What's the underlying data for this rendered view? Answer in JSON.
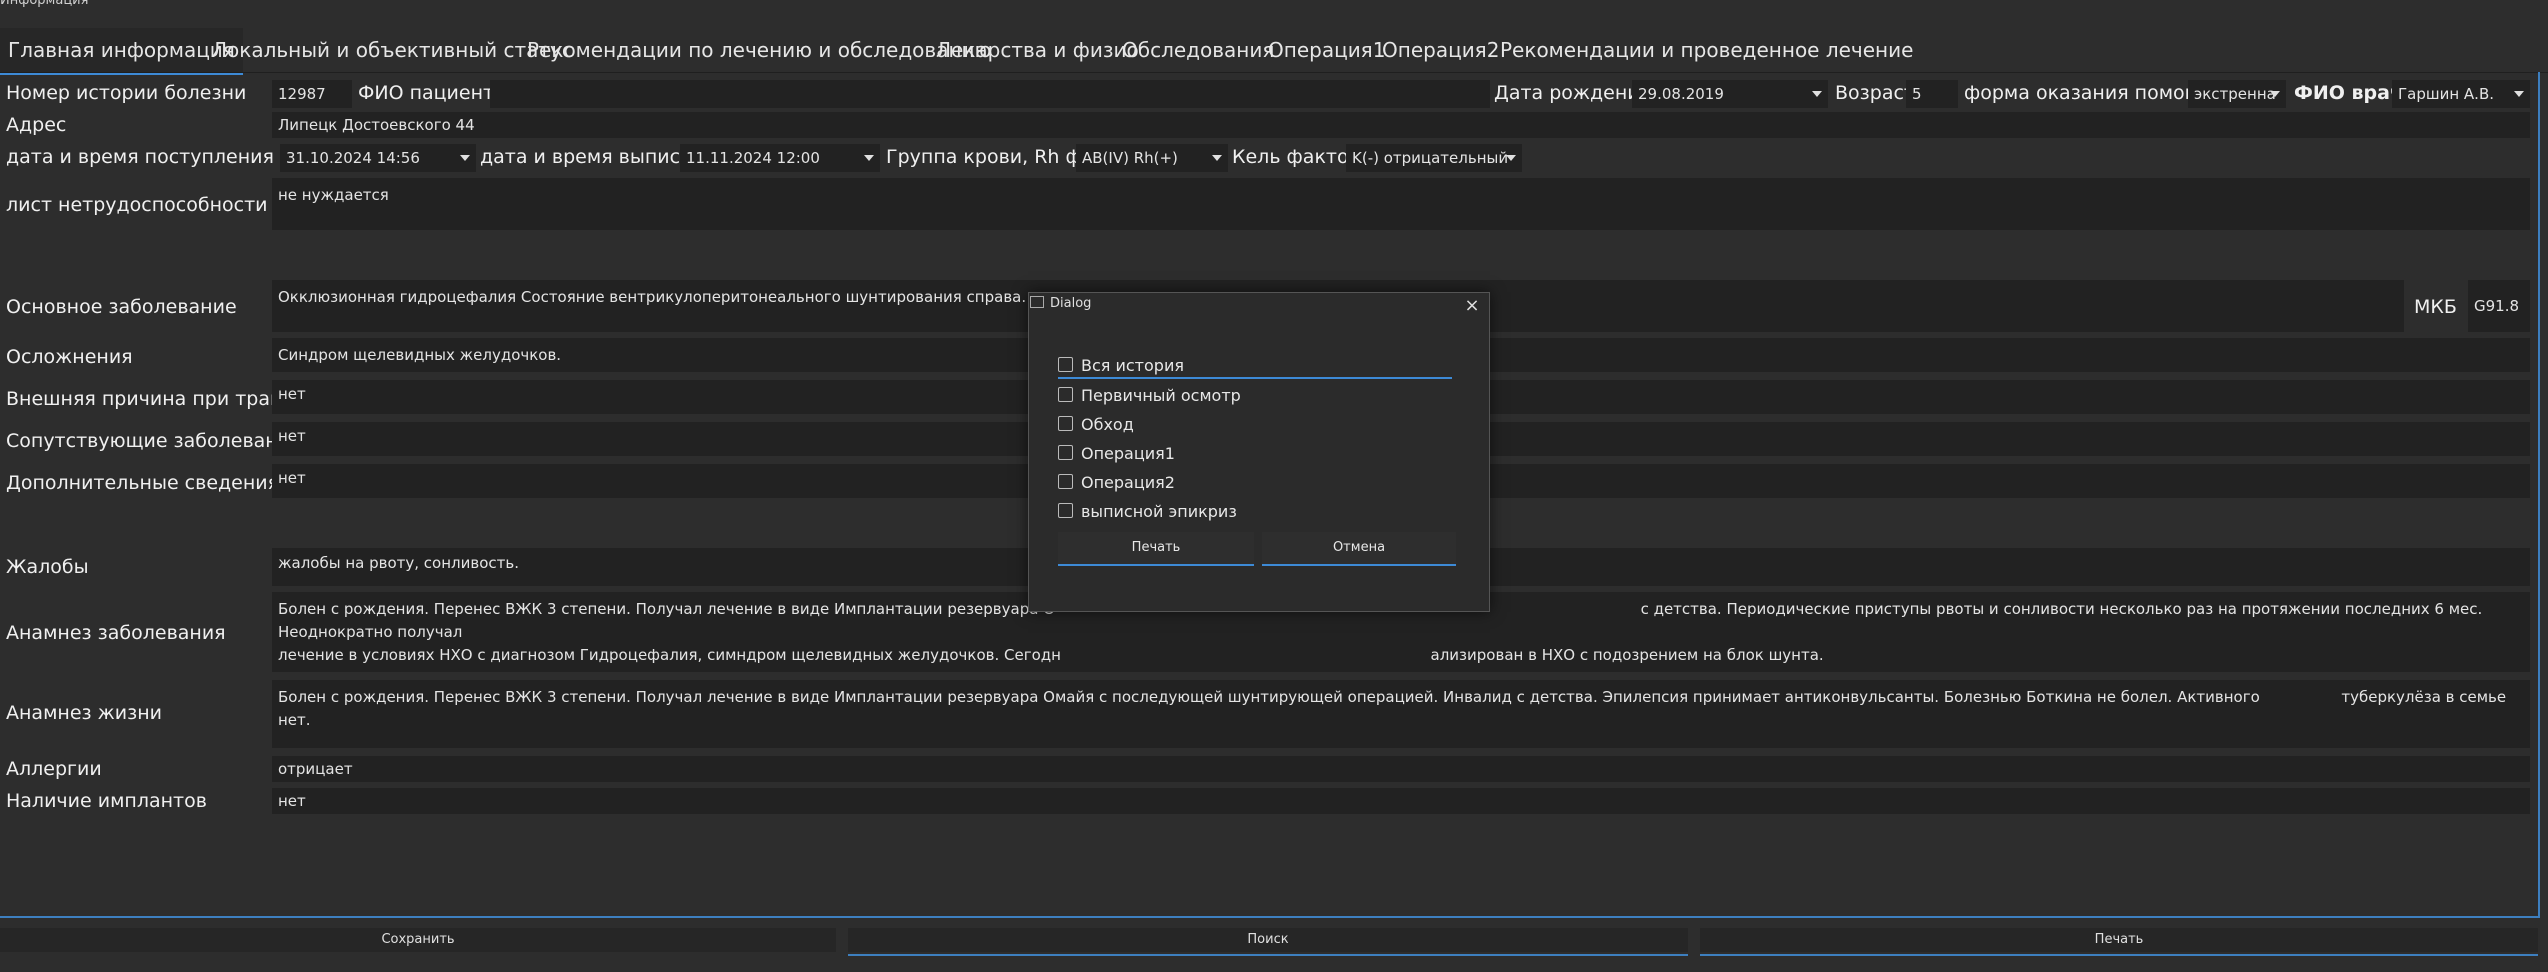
{
  "window": {
    "title": "Информация"
  },
  "tabs": [
    "Главная информация",
    "Локальный и объективный статус",
    "Рекомендации по лечению и обследованию",
    "Лекарства и физио",
    "Обследования",
    "Операция1",
    "Операция2",
    "Рекомендации и проведенное лечение"
  ],
  "form": {
    "history_label": "Номер истории болезни",
    "history_value": "12987",
    "patient_label": "ФИО пациента",
    "patient_value": "",
    "birth_label": "Дата рождения",
    "birth_value": "29.08.2019",
    "age_label": "Возраст",
    "age_value": "5",
    "care_label": "форма оказания помощи",
    "care_value": "экстренна",
    "doctor_label": "ФИО врача",
    "doctor_value": "Гаршин А.В.",
    "address_label": "Адрес",
    "address_value": "Липецк Достоевского 44",
    "admit_label": "дата и время поступления",
    "admit_value": "31.10.2024 14:56",
    "discharge_label": "дата и время выписки",
    "discharge_value": "11.11.2024 12:00",
    "blood_label": "Группа крови, Rh ф-р",
    "blood_value": "AB(IV) Rh(+)",
    "kell_label": "Кель фактор",
    "kell_value": "K(-) отрицательный",
    "sick_label": "лист нетрудоспособности",
    "sick_value": "не нуждается",
    "main_label": "Основное заболевание",
    "main_value": "Окклюзионная гидроцефалия Состояние вентрикулоперитонеального шунтирования справа.",
    "mkb_label": "МКБ",
    "mkb_value": "G91.8",
    "compl_label": "Осложнения",
    "compl_value": "Синдром щелевидных желудочков.",
    "ext_label": "Внешняя причина при травмах",
    "ext_value": "нет",
    "concom_label": "Сопутствующие заболевания",
    "concom_value": "нет",
    "extra_label": "Дополнительные сведения",
    "extra_value": "нет",
    "complaints_label": "Жалобы",
    "complaints_value": "жалобы на рвоту, сонливость.",
    "anam_label": "Анамнез заболевания",
    "anam_line1_a": "Болен с рождения. Перенес ВЖК 3 степени. Получал лечение в виде Имплантации резервуара О",
    "anam_line1_b": "с детства. Периодические приступы рвоты и сонливости несколько раз на протяжении последних 6 мес. Неоднократно получал",
    "anam_line2_a": "лечение в условиях НХО с диагнозом Гидроцефалия, симндром щелевидных желудочков. Сегодн",
    "anam_line2_b": "ализирован в НХО с подозрением на блок шунта.",
    "life_label": "Анамнез жизни",
    "life_value_a": "Болен с рождения. Перенес ВЖК 3 степени. Получал лечение в виде Имплантации резервуара Омайя с последующей шунтирующей операцией. Инвалид с детства. Эпилепсия принимает антиконвульсанты. Болезнью Боткина не болел. Активного",
    "life_value_b": "туберкулёза в семье нет.",
    "allergy_label": "Аллергии",
    "allergy_value": "отрицает",
    "implant_label": "Наличие имплантов",
    "implant_value": "нет"
  },
  "dialog": {
    "title": "Dialog",
    "options": [
      "Вся история",
      "Первичный осмотр",
      "Обход",
      "Операция1",
      "Операция2",
      "выписной эпикриз"
    ],
    "print_label": "Печать",
    "cancel_label": "Отмена"
  },
  "footer": {
    "save_label": "Сохранить",
    "search_label": "Поиск",
    "print_label": "Печать"
  },
  "colors": {
    "accent": "#3d8ad6",
    "background": "#2d2d2d",
    "field": "#222222"
  }
}
